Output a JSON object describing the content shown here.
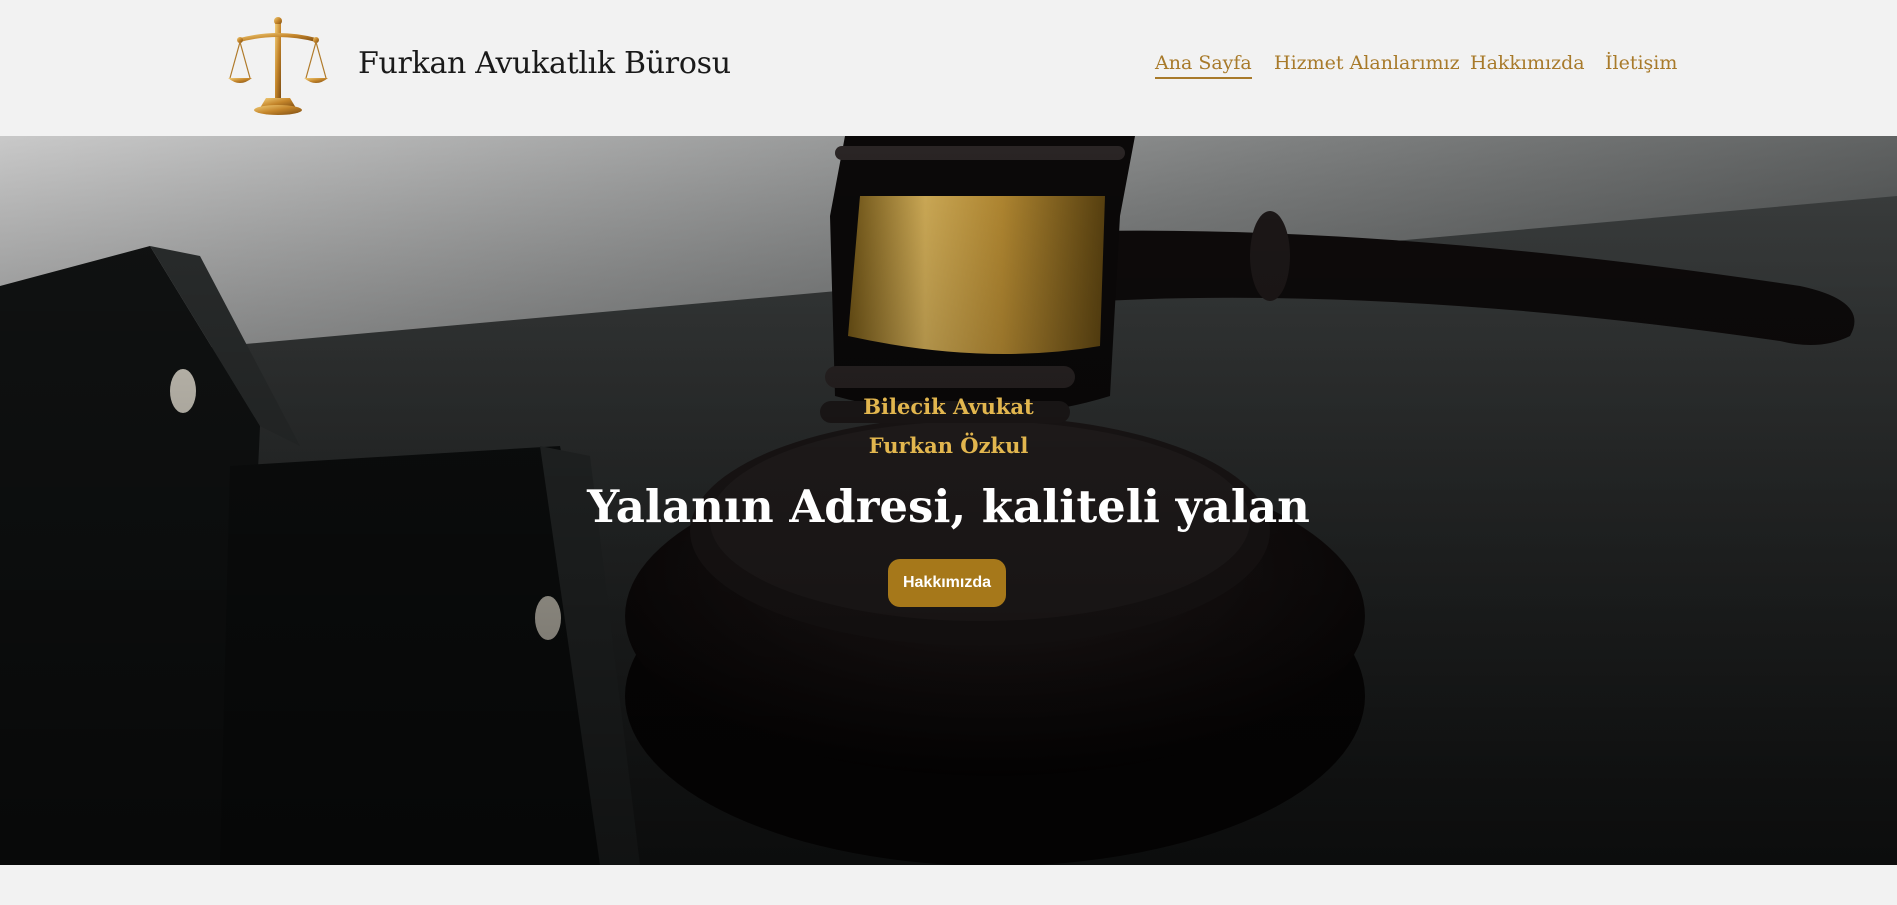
{
  "brand": {
    "name": "Furkan Avukatlık Bürosu",
    "logo_icon": "scales-of-justice-icon"
  },
  "nav": {
    "items": [
      {
        "label": "Ana Sayfa",
        "active": true
      },
      {
        "label": "Hizmet Alanlarımız",
        "active": false
      },
      {
        "label": "Hakkımızda",
        "active": false
      },
      {
        "label": "İletişim",
        "active": false
      }
    ]
  },
  "hero": {
    "subtitle_line1": "Bilecik Avukat",
    "subtitle_line2": "Furkan Özkul",
    "title": "Yalanın Adresi, kaliteli yalan",
    "button_label": "Hakkımızda",
    "background_icon": "judge-gavel-photo"
  },
  "colors": {
    "accent": "#a87a2a",
    "button": "#a6781a",
    "subtitle": "#e2b64e",
    "header_bg": "#f2f2f2"
  }
}
